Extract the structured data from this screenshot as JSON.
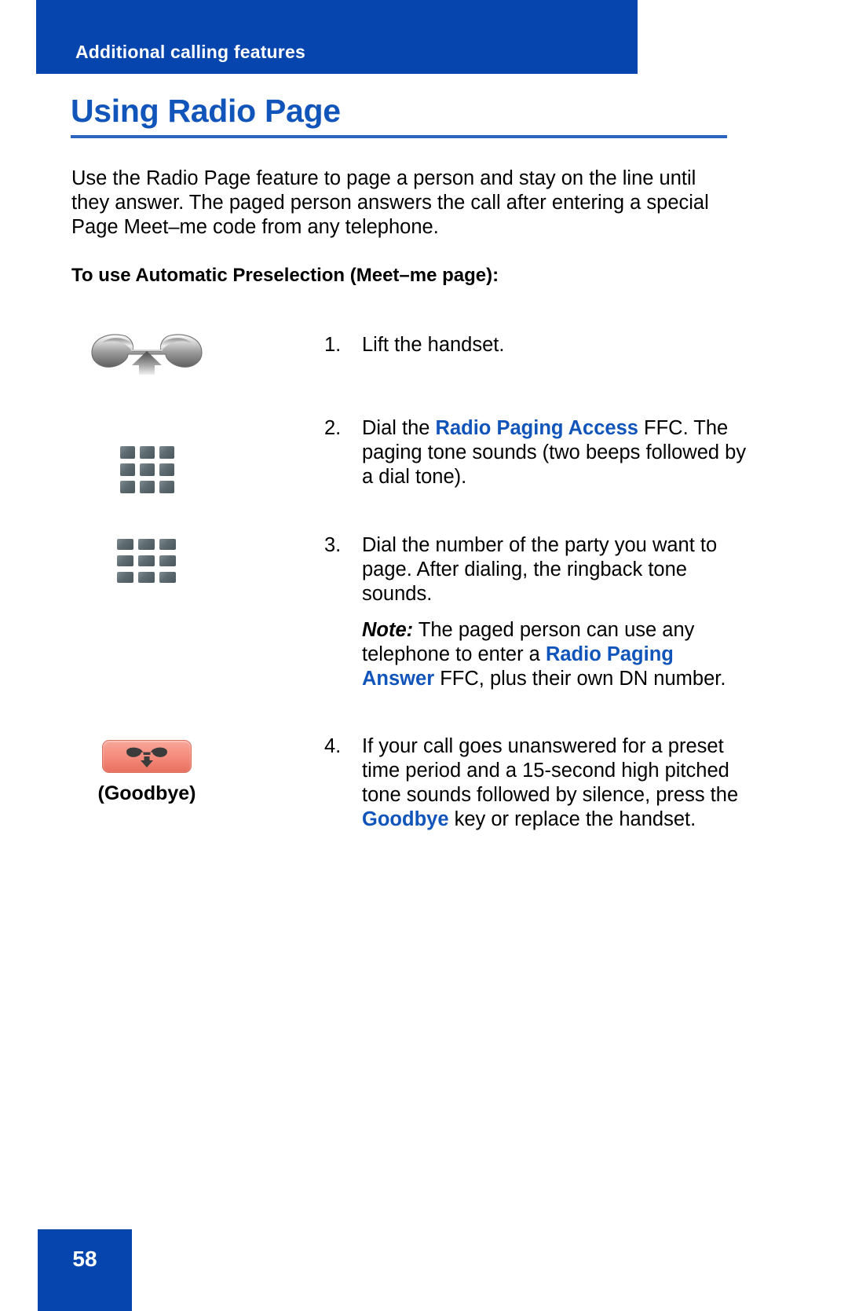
{
  "document": {
    "running_header": "Additional calling features",
    "page_title": "Using Radio Page",
    "page_number": "58"
  },
  "colors": {
    "brand_blue": "#0645ad",
    "title_blue": "#1155bb",
    "goodbye_key": "#f4897a",
    "keypad_grey": "#5d6a70"
  },
  "body": {
    "intro": "Use the Radio Page feature to page a person and stay on the line until they answer. The paged person answers the call after entering a special Page Meet–me code from any telephone.",
    "subheading": "To use Automatic Preselection (Meet–me page):"
  },
  "steps": [
    {
      "number": "1.",
      "icon": "handset-lift-icon",
      "icon_label": "",
      "text_parts": [
        {
          "text": "Lift the handset.",
          "style": "normal"
        }
      ]
    },
    {
      "number": "2.",
      "icon": "keypad-icon",
      "icon_label": "",
      "text_parts": [
        {
          "text": "Dial the ",
          "style": "normal"
        },
        {
          "text": "Radio Paging Access",
          "style": "highlight"
        },
        {
          "text": " FFC. The paging tone sounds (two beeps followed by a dial tone).",
          "style": "normal"
        }
      ]
    },
    {
      "number": "3.",
      "icon": "keypad-icon",
      "icon_label": "",
      "text_parts": [
        {
          "text": "Dial the number of the party you want to page. After dialing, the ringback tone sounds.",
          "style": "normal"
        }
      ],
      "note_parts": [
        {
          "text": "Note:",
          "style": "note-lead"
        },
        {
          "text": " The paged person can use any telephone to enter a ",
          "style": "normal"
        },
        {
          "text": "Radio Paging Answer",
          "style": "highlight"
        },
        {
          "text": " FFC, plus their own DN number.",
          "style": "normal"
        }
      ]
    },
    {
      "number": "4.",
      "icon": "goodbye-key-icon",
      "icon_label": "(Goodbye)",
      "text_parts": [
        {
          "text": "If your call goes unanswered for a preset time period and a 15-second high pitched tone sounds followed by silence, press the ",
          "style": "normal"
        },
        {
          "text": "Goodbye",
          "style": "highlight"
        },
        {
          "text": " key or replace the handset.",
          "style": "normal"
        }
      ]
    }
  ]
}
